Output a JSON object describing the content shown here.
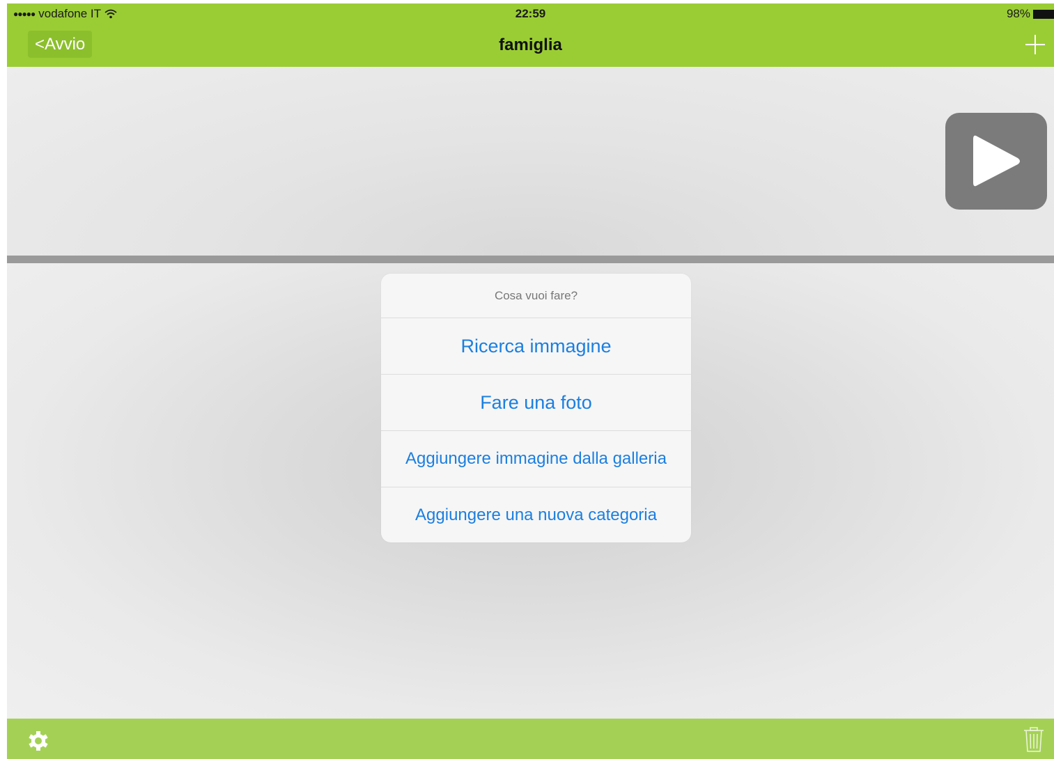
{
  "status_bar": {
    "signal": "●●●●●",
    "carrier": "vodafone IT",
    "time": "22:59",
    "battery": "98%"
  },
  "navbar": {
    "back_label": "<Avvio",
    "title": "famiglia",
    "add_icon": "plus-icon"
  },
  "player": {
    "play_icon": "play-icon"
  },
  "action_sheet": {
    "title": "Cosa vuoi fare?",
    "options": [
      {
        "label": "Ricerca immagine"
      },
      {
        "label": "Fare una foto"
      },
      {
        "label": "Aggiungere immagine dalla galleria"
      },
      {
        "label": "Aggiungere una nuova categoria"
      }
    ]
  },
  "toolbar": {
    "settings_icon": "gear-icon",
    "delete_icon": "trash-icon"
  },
  "colors": {
    "header_green": "#9acd34",
    "toolbar_green": "#a4d155",
    "accent_blue": "#1b7fe0"
  }
}
